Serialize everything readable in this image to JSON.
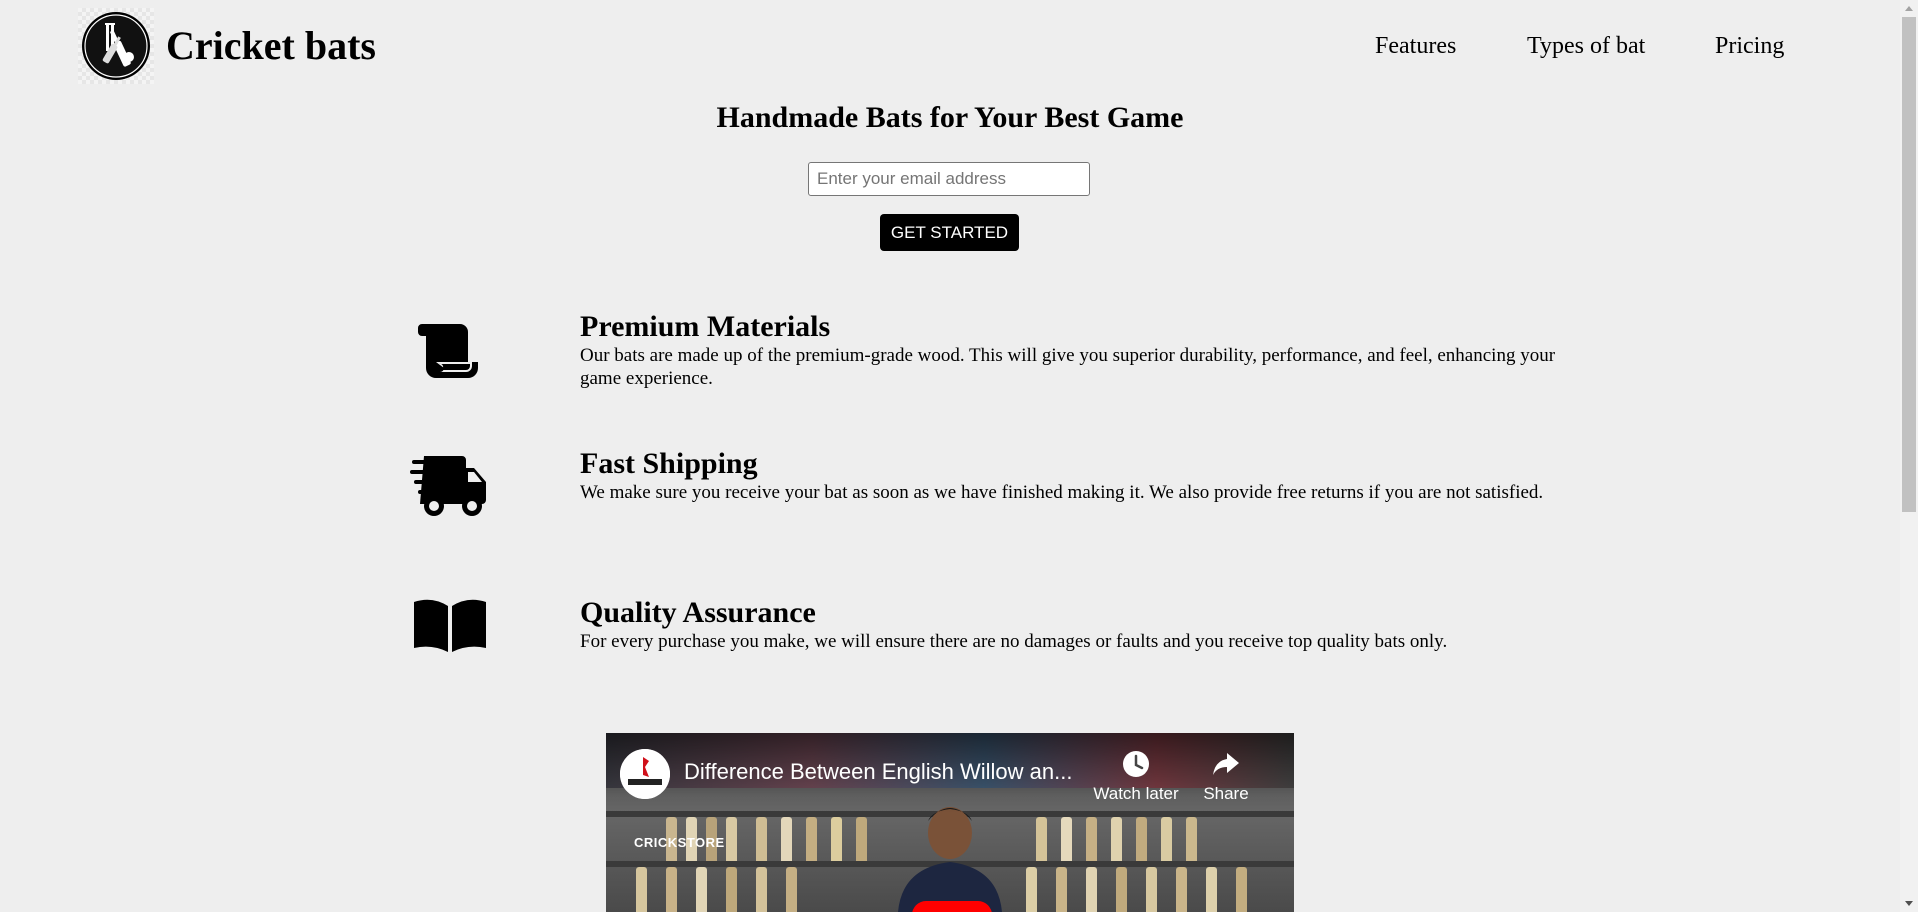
{
  "header": {
    "brand": "Cricket bats",
    "nav": [
      {
        "label": "Features"
      },
      {
        "label": "Types of bat"
      },
      {
        "label": "Pricing"
      }
    ]
  },
  "hero": {
    "title": "Handmade Bats for Your Best Game",
    "email_placeholder": "Enter your email address",
    "email_value": "",
    "cta_label": "GET STARTED"
  },
  "features": [
    {
      "icon": "scroll-icon",
      "title": "Premium Materials",
      "text": "Our bats are made up of the premium-grade wood. This will give you superior durability, performance, and feel, enhancing your game experience."
    },
    {
      "icon": "shipping-truck-icon",
      "title": "Fast Shipping",
      "text": "We make sure you receive your bat as soon as we have finished making it. We also provide free returns if you are not satisfied."
    },
    {
      "icon": "open-book-icon",
      "title": "Quality Assurance",
      "text": "For every purchase you make, we will ensure there are no damages or faults and you receive top quality bats only."
    }
  ],
  "video": {
    "title": "Difference Between English Willow an...",
    "watch_later_label": "Watch later",
    "share_label": "Share",
    "channel_mark": "CRICKSTORE",
    "play_color": "#ff0000"
  },
  "colors": {
    "page_background": "#eeeeee",
    "button_background": "#000000",
    "button_text": "#ffffff"
  }
}
